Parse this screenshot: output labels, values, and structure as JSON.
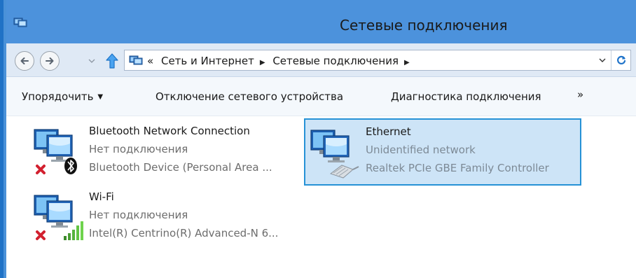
{
  "window": {
    "title": "Сетевые подключения"
  },
  "address": {
    "overflow_marker": "«",
    "crumbs": [
      "Сеть и Интернет",
      "Сетевые подключения"
    ],
    "separator": "▶"
  },
  "toolbar": {
    "organize_label": "Упорядочить",
    "organize_caret": "▼",
    "disable_label": "Отключение сетевого устройства",
    "diagnose_label": "Диагностика подключения",
    "more_label": "»"
  },
  "connections": [
    {
      "name": "Bluetooth Network Connection",
      "status": "Нет подключения",
      "device": "Bluetooth Device (Personal Area ...",
      "icon": "bluetooth-network-icon",
      "disconnected": true
    },
    {
      "name": "Ethernet",
      "status": "Unidentified network",
      "device": "Realtek PCIe GBE Family Controller",
      "icon": "ethernet-network-icon",
      "selected": true
    },
    {
      "name": "Wi-Fi",
      "status": "Нет подключения",
      "device": "Intel(R) Centrino(R) Advanced-N 6...",
      "icon": "wifi-network-icon",
      "disconnected": true
    }
  ],
  "colors": {
    "titlebar": "#4c92dc",
    "navbar": "#dfe9f5",
    "selection_fill": "#cde4f7",
    "selection_border": "#2692d6",
    "error_red": "#d2202f",
    "refresh_blue": "#1f73c9"
  }
}
